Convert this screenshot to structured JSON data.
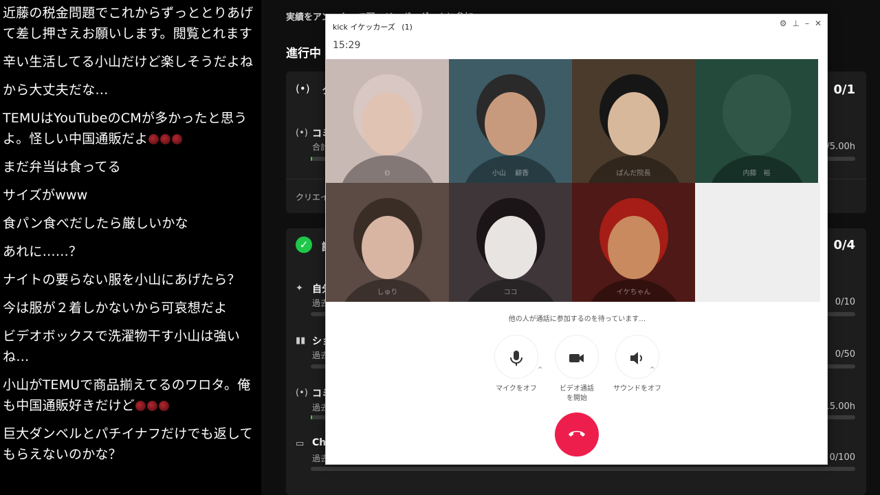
{
  "chat": {
    "messages": [
      {
        "text": "近藤の税金問題でこれからずっととりあげて差し押さえお願いします。閲覧とれます",
        "emoji": 0
      },
      {
        "text": "辛い生活してる小山だけど楽しそうだよね",
        "emoji": 0
      },
      {
        "text": "から大丈夫だな…",
        "emoji": 0
      },
      {
        "text": "TEMUはYouTubeのCMが多かったと思うよ。怪しい中国通販だよ",
        "emoji": 3
      },
      {
        "text": "まだ弁当は食ってる",
        "emoji": 0
      },
      {
        "text": "サイズがwww",
        "emoji": 0
      },
      {
        "text": "食パン食べだしたら厳しいかな",
        "emoji": 0
      },
      {
        "text": "あれに……？",
        "emoji": 0
      },
      {
        "text": "ナイトの要らない服を小山にあげたら？",
        "emoji": 0
      },
      {
        "text": "今は服が２着しかないから可哀想だよ",
        "emoji": 0
      },
      {
        "text": "ビデオボックスで洗濯物干す小山は強いね…",
        "emoji": 0
      },
      {
        "text": "小山がTEMUで商品揃えてるのワロタ。俺も中国通販好きだけど",
        "emoji": 3
      },
      {
        "text": "巨大ダンベルとパチイナフだけでも返してもらえないのかな？",
        "emoji": 0
      }
    ]
  },
  "dashboard": {
    "top_text": "実績をアン…ク…て配…ジ…ボ…グ…ムに参加",
    "section_heading": "進行中",
    "card1": {
      "icon": "broadcast-icon",
      "title": "ク",
      "count": "0/1",
      "row": {
        "title": "コミ",
        "sub": "合計",
        "value": "/5.00h"
      },
      "footer": "クリエイ"
    },
    "card2": {
      "icon": "verified-check-icon",
      "title": "認",
      "count": "0/4",
      "rows": [
        {
          "icon": "sparkle-icon",
          "title": "自分",
          "sub": "過去",
          "value": "0/10"
        },
        {
          "icon": "people-icon",
          "title": "ショ",
          "sub": "過去",
          "value": "0/50"
        },
        {
          "icon": "broadcast-icon",
          "title": "コミ",
          "sub": "過去",
          "value": "15.00h"
        },
        {
          "icon": "chat-icon",
          "title": "Ch",
          "sub": "過去",
          "value": "0/100"
        }
      ]
    },
    "colors": {
      "accent_green": "#1fc84a",
      "progress_green": "#2fd34a"
    }
  },
  "call": {
    "title": "kick イケッカーズ",
    "count": "(1)",
    "elapsed": "15:29",
    "participants": [
      {
        "name": "Ð",
        "bg": "#c9b9b4",
        "face": "#e1c3b3",
        "hair": "#d8c7c2"
      },
      {
        "name": "小山 　顧香",
        "bg": "#3d5c66",
        "face": "#c89a7d",
        "hair": "#2a2a2a"
      },
      {
        "name": "ぱんだ院長",
        "bg": "#4a3b2c",
        "face": "#d8b89a",
        "hair": "#161616"
      },
      {
        "name": "内藤　裕",
        "bg": "#244a3c",
        "face": "#2f5646",
        "hair": "#2f5646"
      },
      {
        "name": "しゅり",
        "bg": "#5c4a44",
        "face": "#d8b5a3",
        "hair": "#3a2d26"
      },
      {
        "name": "ココ",
        "bg": "#3e3638",
        "face": "#e8e4e2",
        "hair": "#1b1517"
      },
      {
        "name": "イケちゃん",
        "bg": "#4e1916",
        "face": "#c88a5e",
        "hair": "#a51d16"
      }
    ],
    "waiting_text": "他の人が通話に参加するのを待っています…",
    "controls": {
      "mic_label": "マイクをオフ",
      "video_label": "ビデオ通話を開始",
      "sound_label": "サウンドをオフ"
    },
    "hangup_color": "#ee1e4c"
  }
}
